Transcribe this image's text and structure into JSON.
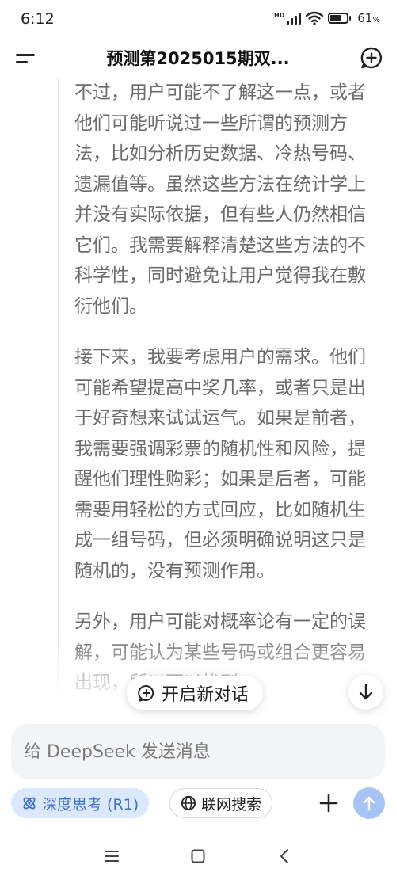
{
  "status_bar": {
    "time": "6:12",
    "network_badge": "HD",
    "battery_level": 61,
    "battery_text": "61",
    "battery_unit": "%"
  },
  "header": {
    "title": "预测第2025015期双...",
    "menu_icon": "menu-icon",
    "new_chat_icon": "plus-circle-icon"
  },
  "thinking": {
    "paragraphs": [
      "不过，用户可能不了解这一点，或者他们可能听说过一些所谓的预测方法，比如分析历史数据、冷热号码、遗漏值等。虽然这些方法在统计学上并没有实际依据，但有些人仍然相信它们。我需要解释清楚这些方法的不科学性，同时避免让用户觉得我在敷衍他们。",
      "接下来，我要考虑用户的需求。他们可能希望提高中奖几率，或者只是出于好奇想来试试运气。如果是前者，我需要强调彩票的随机性和风险，提醒他们理性购彩；如果是后者，可能需要用轻松的方式回应，比如随机生成一组号码，但必须明确说明这只是随机的，没有预测作用。",
      "另外，用户可能对概率论有一定的误解，可能认为某些号码或组合更容易出现，所以可以找到"
    ]
  },
  "floating": {
    "new_chat_label": "开启新对话",
    "scroll_down_icon": "arrow-down-icon"
  },
  "input": {
    "placeholder": "给 DeepSeek 发送消息",
    "value": ""
  },
  "toolbar": {
    "deep_think_label": "深度思考 (R1)",
    "web_search_label": "联网搜索",
    "add_icon": "plus-icon",
    "send_icon": "arrow-up-icon"
  },
  "colors": {
    "accent": "#3b6fd9",
    "accent_bg": "#dbe8fd",
    "send_disabled": "#a8c3f5",
    "thinking_text": "#6b6b6b"
  },
  "nav_bar": {
    "icons": [
      "menu-lines-icon",
      "home-square-icon",
      "back-chevron-icon"
    ]
  }
}
